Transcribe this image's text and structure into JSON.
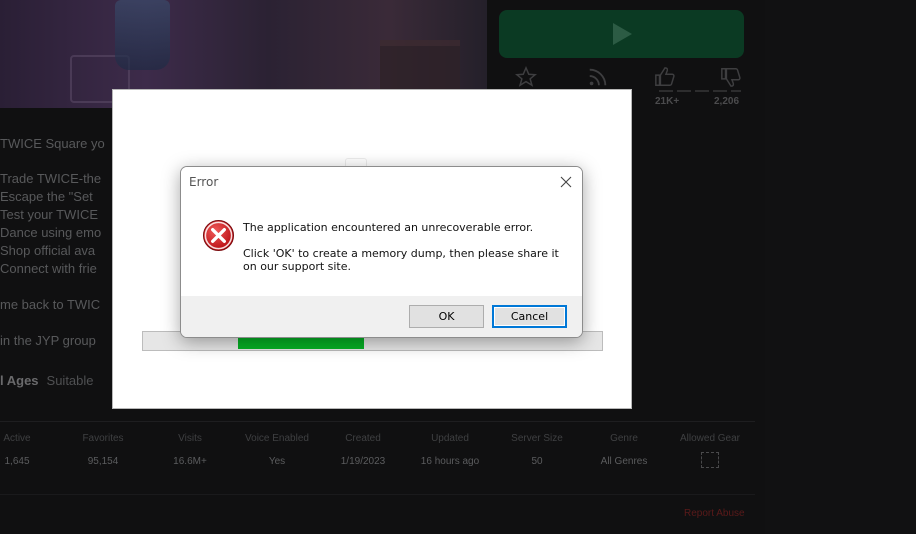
{
  "background_page": {
    "description_lines": [
      "TWICE Square yo",
      "Trade TWICE-the",
      "Escape the \"Set",
      "Test your TWICE",
      "Dance using emo",
      "Shop official ava",
      "Connect with frie",
      "me back to TWIC",
      "in the JYP group"
    ],
    "age_rating": "l Ages",
    "age_suitable": "Suitable",
    "votes": {
      "up": "21K+",
      "down": "2,206"
    },
    "stats": [
      {
        "label": "Active",
        "value": "1,645"
      },
      {
        "label": "Favorites",
        "value": "95,154"
      },
      {
        "label": "Visits",
        "value": "16.6M+"
      },
      {
        "label": "Voice Enabled",
        "value": "Yes"
      },
      {
        "label": "Created",
        "value": "1/19/2023"
      },
      {
        "label": "Updated",
        "value": "16 hours ago"
      },
      {
        "label": "Server Size",
        "value": "50"
      },
      {
        "label": "Genre",
        "value": "All Genres"
      },
      {
        "label": "Allowed Gear",
        "value": ""
      }
    ],
    "report_link": "Report Abuse",
    "play_button_color": "#0b3a23"
  },
  "launcher": {
    "progress_percent": 27.5,
    "progress_color": "#06b025"
  },
  "dialog": {
    "title": "Error",
    "message_line1": "The application encountered an unrecoverable error.",
    "message_line2": "Click 'OK' to create a memory dump, then please share it on our support site.",
    "icon": "error-x-icon",
    "ok_label": "OK",
    "cancel_label": "Cancel",
    "error_color": "#d6151b"
  }
}
